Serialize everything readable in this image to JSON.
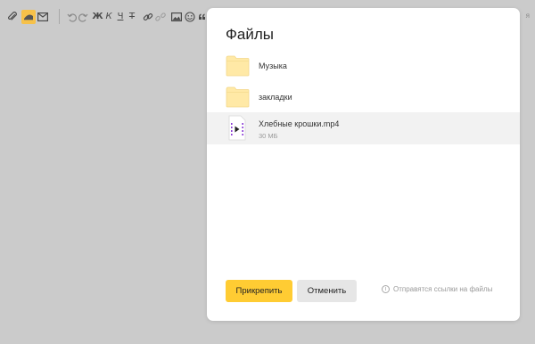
{
  "toolbar": {
    "buttons": [
      {
        "name": "attach-icon"
      },
      {
        "name": "disk-icon"
      },
      {
        "name": "mail-icon"
      },
      {
        "name": "undo-icon"
      },
      {
        "name": "redo-icon"
      },
      {
        "name": "bold-button",
        "label": "Ж"
      },
      {
        "name": "italic-button",
        "label": "К"
      },
      {
        "name": "underline-button",
        "label": "Ч"
      },
      {
        "name": "strikethrough-button",
        "label": "Т"
      },
      {
        "name": "link-icon"
      },
      {
        "name": "unlink-icon"
      },
      {
        "name": "image-icon"
      },
      {
        "name": "emoji-icon"
      },
      {
        "name": "quote-icon"
      }
    ],
    "right_text": "я",
    "accent": "#f6c14a"
  },
  "modal": {
    "title": "Файлы",
    "files": [
      {
        "name": "Музыка",
        "type": "folder",
        "size": ""
      },
      {
        "name": "закладки",
        "type": "folder",
        "size": ""
      },
      {
        "name": "Хлебные крошки.mp4",
        "type": "video",
        "size": "30 МБ",
        "selected": true
      }
    ],
    "attach_label": "Прикрепить",
    "cancel_label": "Отменить",
    "hint": "Отправятся ссылки на файлы",
    "colors": {
      "primary": "#ffcc33",
      "folder": "#ffe9a6",
      "video_accent": "#8a3cd4"
    }
  }
}
